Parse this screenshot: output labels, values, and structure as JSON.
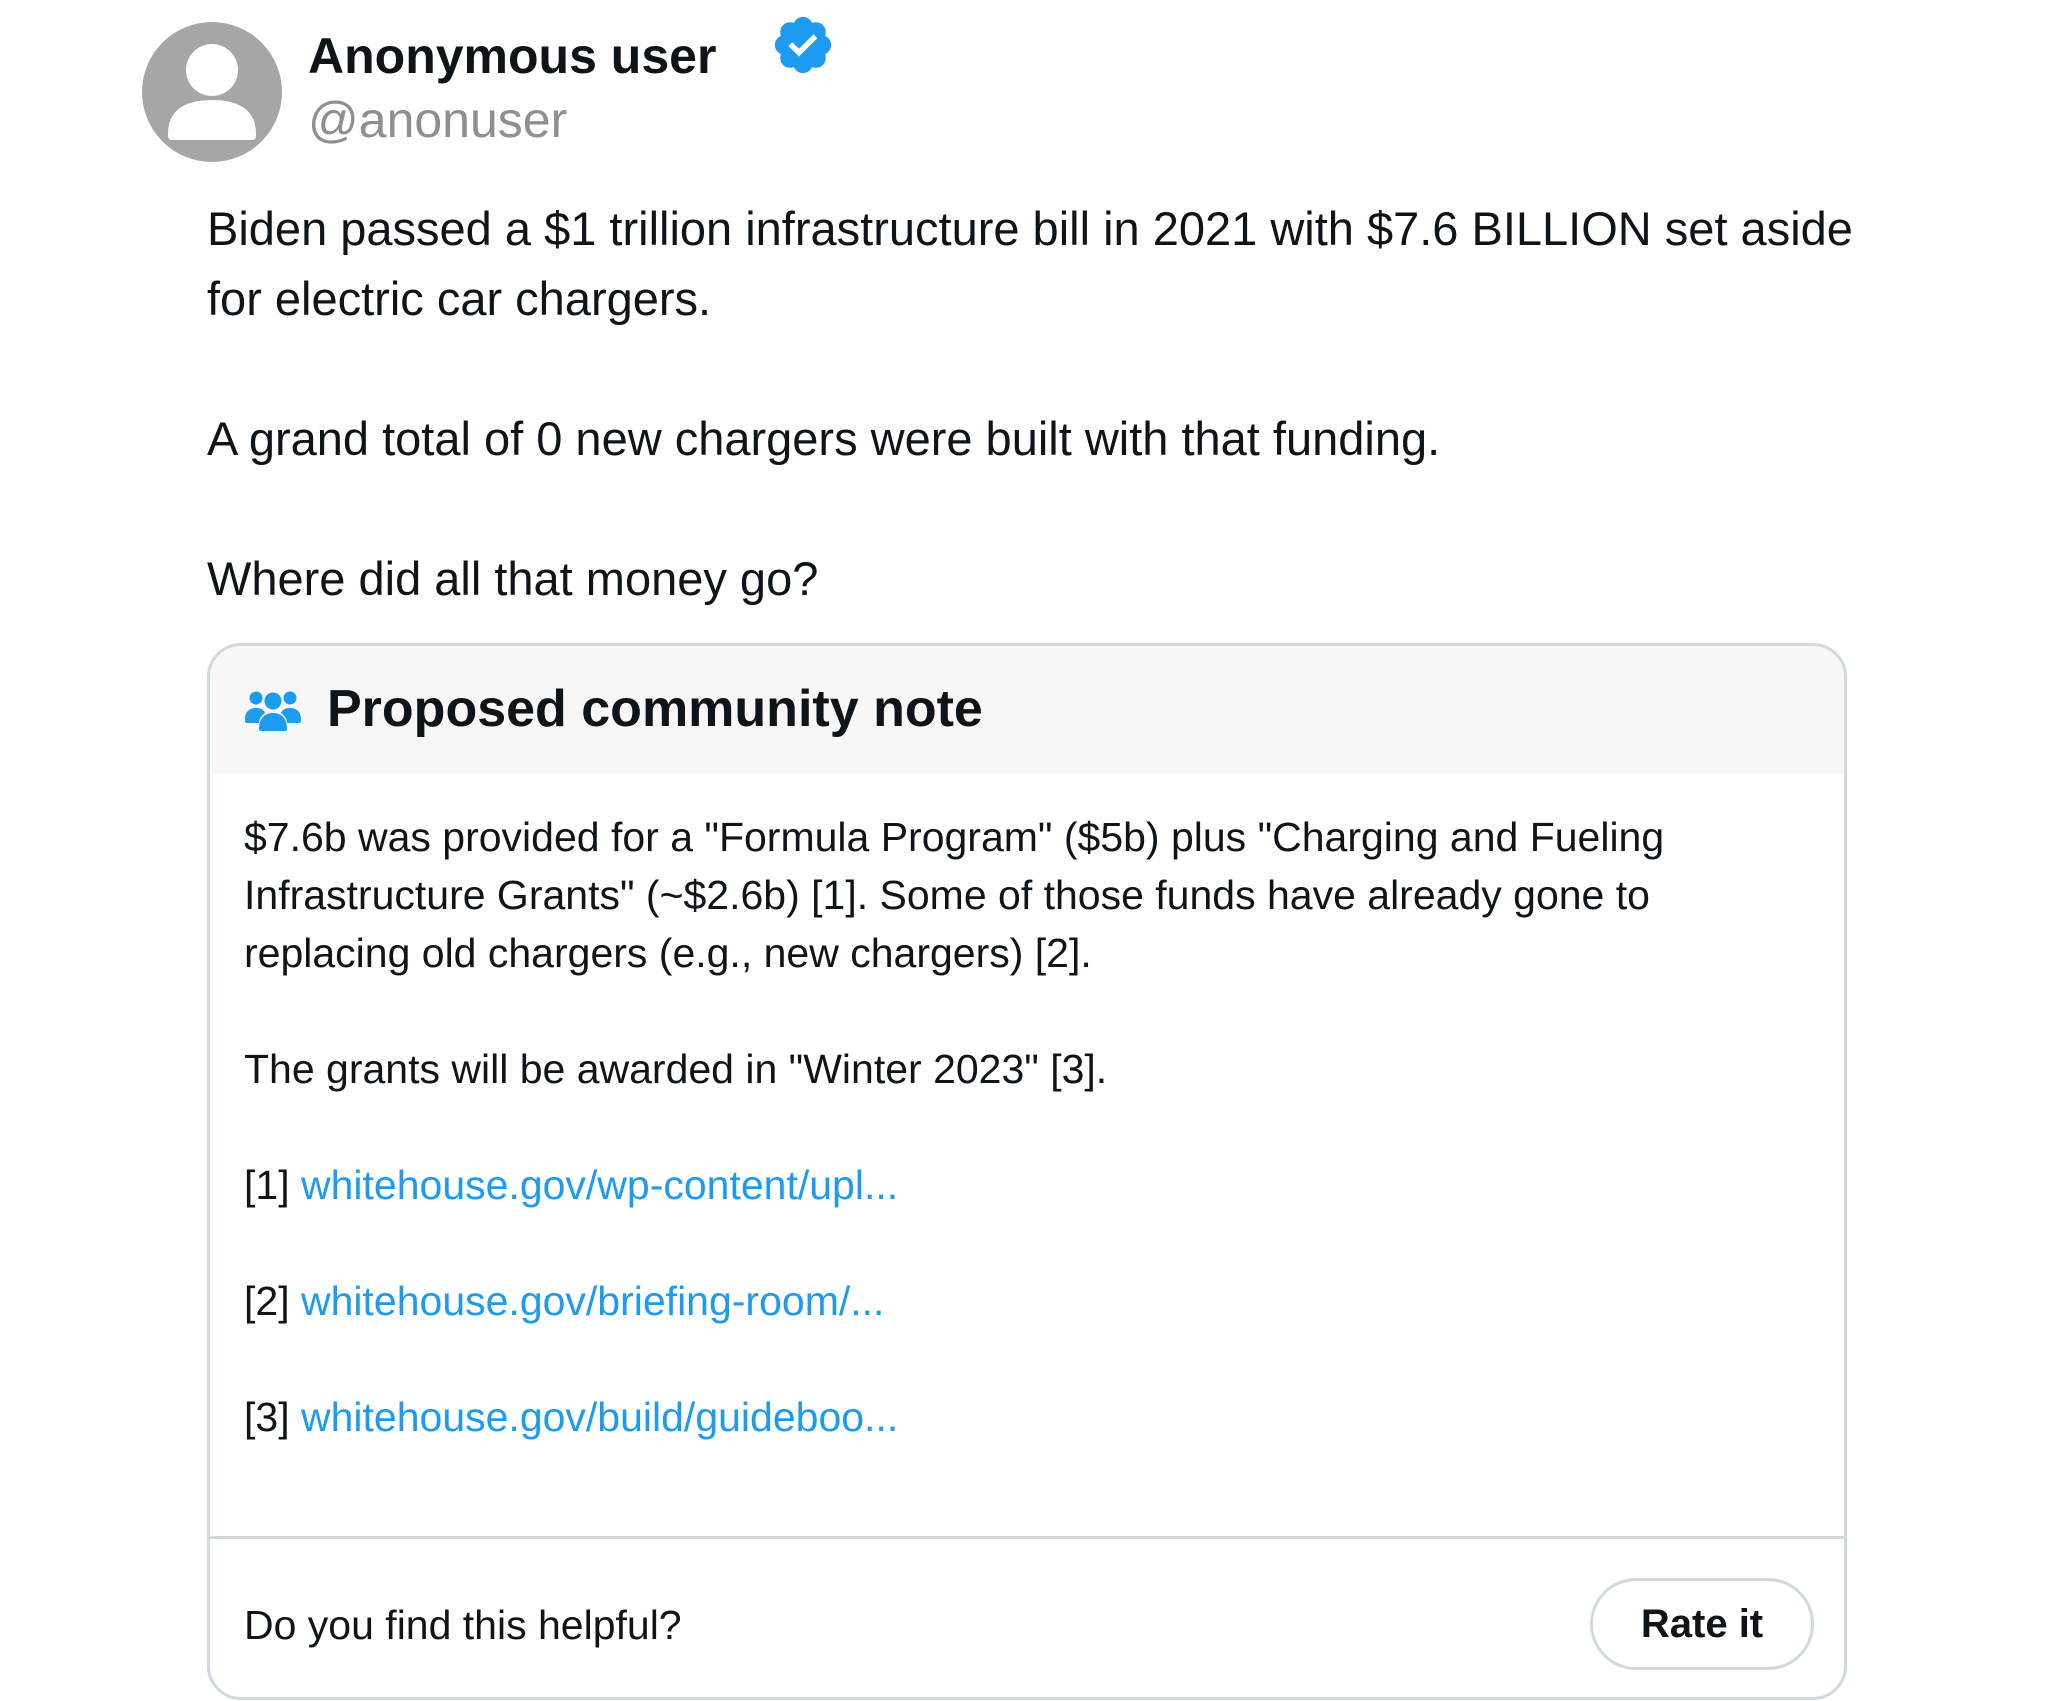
{
  "author": {
    "display_name": "Anonymous user",
    "handle": "@anonuser",
    "verified": true,
    "avatar_icon": "default-user-avatar-icon",
    "verified_icon": "verified-badge-icon",
    "verified_color": "#1d9bf0"
  },
  "tweet": {
    "paragraphs": [
      "Biden passed a $1 trillion infrastructure bill in 2021 with $7.6 BILLION set aside for electric car chargers.",
      "A grand total of 0 new chargers were built with that funding.",
      "Where did all that money go?"
    ]
  },
  "community_note": {
    "title": "Proposed community note",
    "header_icon": "people-group-icon",
    "body": [
      "$7.6b was provided for a \"Formula Program\" ($5b) plus \"Charging and Fueling Infrastructure Grants\" (~$2.6b) [1]. Some of those funds have already gone to replacing old chargers (e.g., new chargers) [2].",
      "The grants will be awarded in \"Winter 2023\" [3]."
    ],
    "references": [
      {
        "marker": "[1]",
        "link": "whitehouse.gov/wp-content/upl..."
      },
      {
        "marker": "[2]",
        "link": "whitehouse.gov/briefing-room/..."
      },
      {
        "marker": "[3]",
        "link": "whitehouse.gov/build/guideboo..."
      }
    ],
    "helpful_question": "Do you find this helpful?",
    "rate_button_label": "Rate it"
  },
  "colors": {
    "link": "#1d9bf0",
    "border": "#cfd9de",
    "header_background": "#f7f7f7",
    "handle_gray": "#8f8f8f"
  }
}
